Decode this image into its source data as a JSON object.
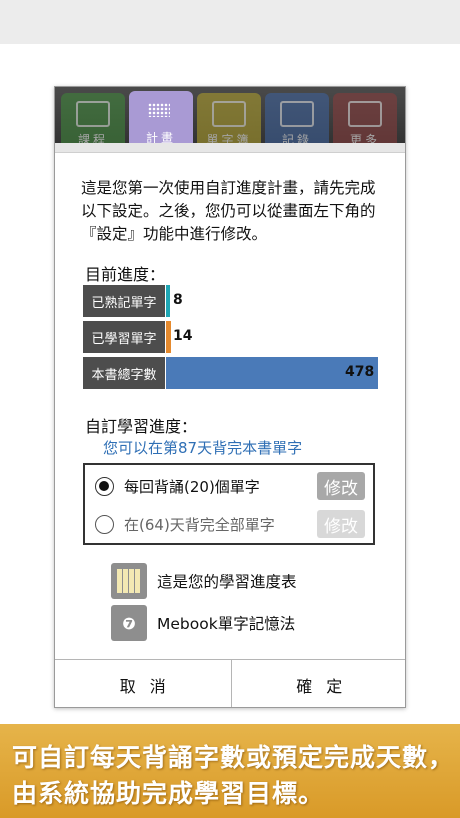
{
  "tabs": [
    {
      "label": "課程",
      "icon": "blackboard-icon"
    },
    {
      "label": "計畫",
      "icon": "calendar-dots-icon"
    },
    {
      "label": "單字簿",
      "icon": "card-icon"
    },
    {
      "label": "記錄",
      "icon": "bar-chart-icon"
    },
    {
      "label": "更多",
      "icon": "settings-box-icon"
    }
  ],
  "intro_text": "這是您第一次使用自訂進度計畫，請先完成以下設定。之後，您仍可以從畫面左下角的『設定』功能中進行修改。",
  "progress": {
    "title": "目前進度：",
    "rows": [
      {
        "label": "已熟記單字",
        "value": "8",
        "color": "#1fa7b5"
      },
      {
        "label": "已學習單字",
        "value": "14",
        "color": "#e58a2e"
      },
      {
        "label": "本書總字數",
        "value": "478",
        "color": "#4a7ab8"
      }
    ]
  },
  "custom": {
    "title": "自訂學習進度：",
    "hint": "您可以在第87天背完本書單字",
    "options": [
      {
        "text": "每回背誦(20)個單字",
        "selected": true,
        "edit_label": "修改"
      },
      {
        "text": "在(64)天背完全部單字",
        "selected": false,
        "edit_label": "修改"
      }
    ]
  },
  "links": [
    {
      "text": "這是您的學習進度表",
      "icon": "schedule-grid-icon"
    },
    {
      "text": "Mebook單字記憶法",
      "icon": "brain-icon"
    }
  ],
  "footer": {
    "cancel": "取消",
    "confirm": "確定"
  },
  "banner": {
    "line1": "可自訂每天背誦字數或預定完成天數，",
    "line2": "由系統協助完成學習目標。"
  }
}
